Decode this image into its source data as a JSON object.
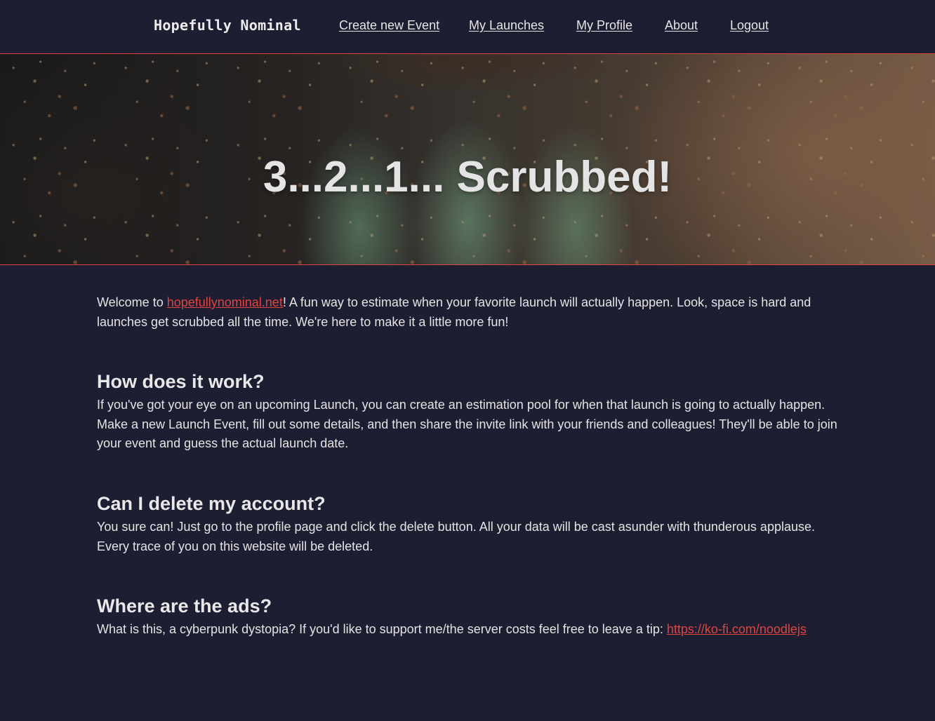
{
  "nav": {
    "brand": "Hopefully Nominal",
    "links": [
      {
        "label": "Create new Event"
      },
      {
        "label": "My Launches"
      },
      {
        "label": "My Profile"
      },
      {
        "label": "About"
      },
      {
        "label": "Logout"
      }
    ]
  },
  "hero": {
    "title": "3...2...1... Scrubbed!"
  },
  "intro": {
    "prefix": "Welcome to ",
    "link": "hopefullynominal.net",
    "suffix": "! A fun way to estimate when your favorite launch will actually happen. Look, space is hard and launches get scrubbed all the time. We're here to make it a little more fun!"
  },
  "faq": [
    {
      "question": "How does it work?",
      "answer": "If you've got your eye on an upcoming Launch, you can create an estimation pool for when that launch is going to actually happen. Make a new Launch Event, fill out some details, and then share the invite link with your friends and colleagues! They'll be able to join your event and guess the actual launch date."
    },
    {
      "question": "Can I delete my account?",
      "answer": "You sure can! Just go to the profile page and click the delete button. All your data will be cast asunder with thunderous applause. Every trace of you on this website will be deleted."
    },
    {
      "question": "Where are the ads?",
      "answer": "What is this, a cyberpunk dystopia? If you'd like to support me/the server costs feel free to leave a tip: ",
      "link": "https://ko-fi.com/noodlejs"
    }
  ],
  "colors": {
    "background": "#1d1e32",
    "accent": "#e0443f",
    "text": "#e4e4e4"
  }
}
